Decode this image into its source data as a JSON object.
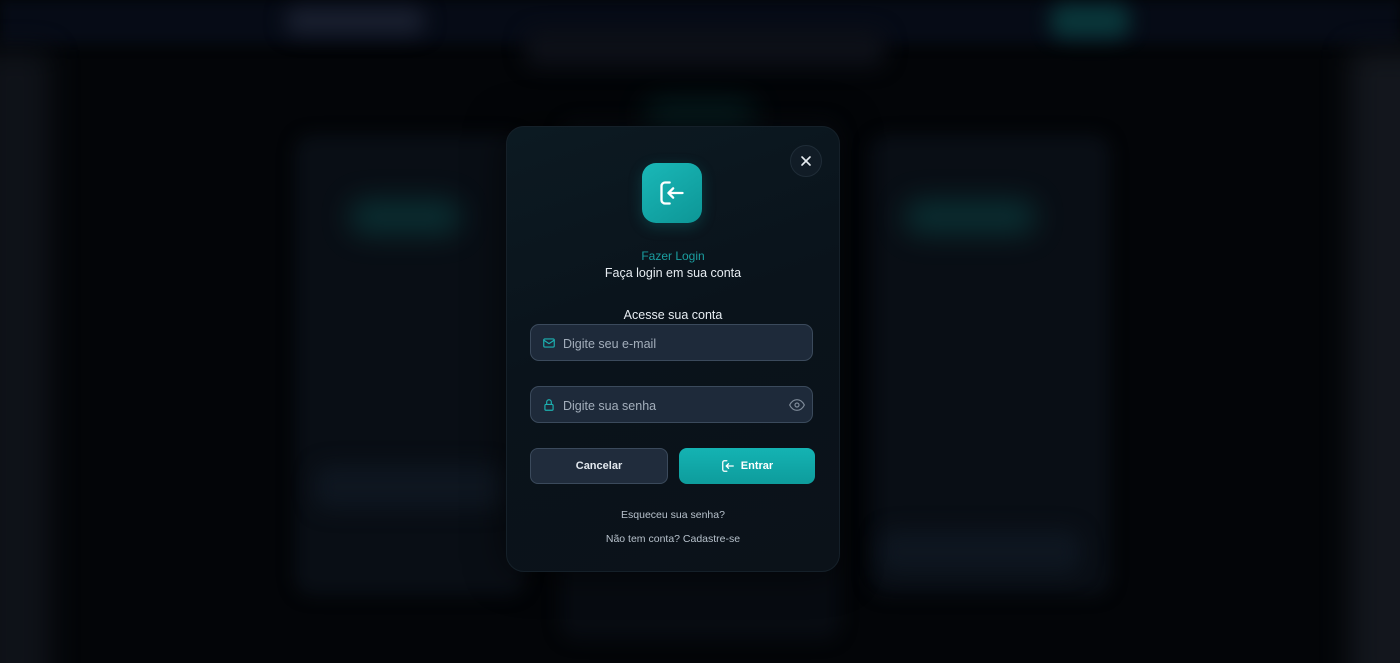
{
  "modal": {
    "kicker": "Fazer Login",
    "title": "Faça login em sua conta",
    "section_label": "Acesse sua conta",
    "email_placeholder": "Digite seu e-mail",
    "password_placeholder": "Digite sua senha",
    "cancel_label": "Cancelar",
    "submit_label": "Entrar",
    "forgot_link": "Esqueceu sua senha?",
    "signup_link": "Não tem conta? Cadastre-se"
  },
  "icons": {
    "close": "close-icon",
    "logo": "login-icon",
    "email": "mail-icon",
    "password": "lock-icon",
    "show_password": "eye-icon",
    "submit": "login-icon"
  },
  "colors": {
    "accent": "#14b3b3",
    "modal_bg": "#0b151d",
    "field_bg": "#1e2a3a",
    "field_border": "#3b4a5c",
    "text_primary": "#e7edf2",
    "text_muted": "#a3aebb"
  }
}
